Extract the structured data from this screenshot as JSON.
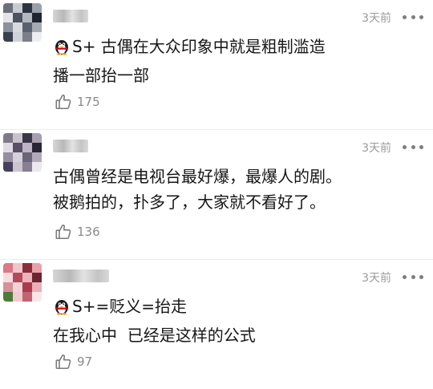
{
  "comments": [
    {
      "username": "",
      "time": "3天前",
      "text": "S+ 古偶在大众印象中就是粗制滥造\n播一部抬一部",
      "has_penguin_tag": true,
      "likes": "175",
      "avatar_colors": [
        "#6a6f78",
        "#c7cad1",
        "#2e3440",
        "#9aa0a8",
        "#e2e4e8",
        "#4c5260",
        "#b3b7bf",
        "#1f2530",
        "#8c9098",
        "#d8dadf",
        "#5b6070",
        "#a6aab2",
        "#3a404c",
        "#cfd2d8",
        "#7a7f88",
        "#eceef1"
      ]
    },
    {
      "username": "",
      "time": "3天前",
      "text": "古偶曾经是电视台最好爆，最爆人的剧。\n被鹅拍的，扑多了，大家就不看好了。",
      "has_penguin_tag": false,
      "likes": "136",
      "avatar_colors": [
        "#7d7a86",
        "#c9c2cc",
        "#3b3548",
        "#a79fb0",
        "#e0dbe3",
        "#584f66",
        "#bdb5c4",
        "#2a2533",
        "#958da0",
        "#d6d0da",
        "#6c6478",
        "#b2aabb",
        "#48405a",
        "#cbc4cf",
        "#877f92",
        "#ece8ee"
      ]
    },
    {
      "username": "",
      "time": "3天前",
      "text": "S+=贬义=抬走\n在我心中  已经是这样的公式",
      "has_penguin_tag": true,
      "likes": "97",
      "avatar_colors": [
        "#d97a86",
        "#f2c4cb",
        "#8a2e3a",
        "#e8a0aa",
        "#f7dde1",
        "#b24a5a",
        "#ecb3bb",
        "#6b2430",
        "#d6909a",
        "#f4d2d7",
        "#a83c4c",
        "#e9b0b8",
        "#4f7a3a",
        "#f0cbd1",
        "#c46472",
        "#f9e6e9"
      ]
    }
  ]
}
